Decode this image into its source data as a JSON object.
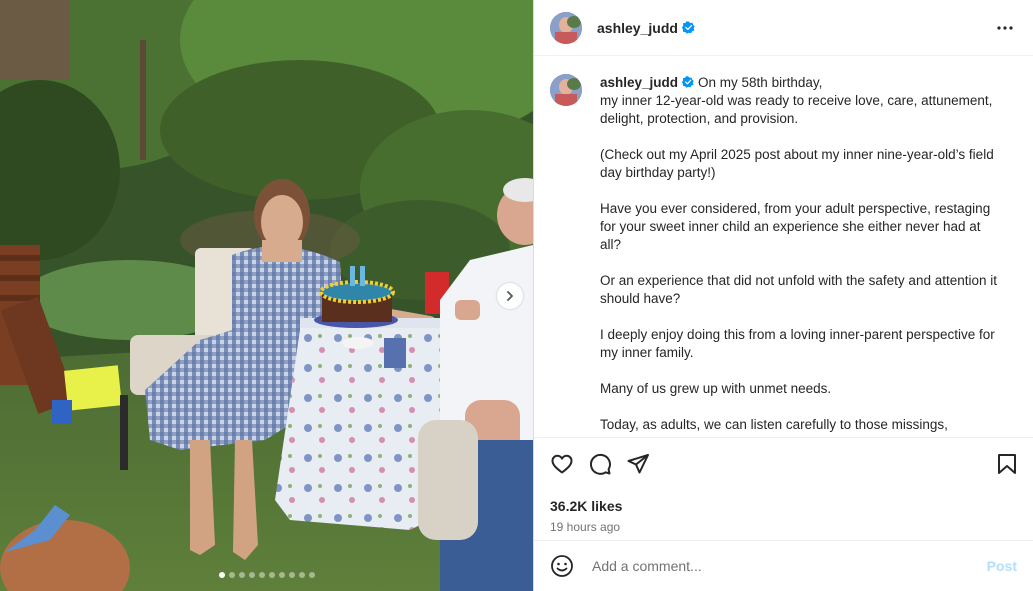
{
  "post": {
    "username": "ashley_judd",
    "verified": true,
    "colors": {
      "verified_badge": "#0095f6",
      "post_button": "#b2dffc",
      "muted_text": "#737373"
    }
  },
  "media": {
    "slide_count": 10,
    "active_slide": 1,
    "next_icon": "chevron-right-icon"
  },
  "caption": {
    "username": "ashley_judd",
    "paragraphs": [
      "On my 58th birthday,\nmy inner 12-year-old was ready to receive love, care, attunement, delight, protection, and provision.",
      "(Check out my April 2025 post about my inner nine-year-old’s field day birthday party!)",
      "Have you ever considered, from your adult perspective, restaging for your sweet inner child an experience she either never had at all?",
      "Or an experience that did not unfold with the safety and attention it should have?",
      "I deeply enjoy doing this from a loving inner-parent perspective for my inner family.",
      "Many of us grew up with unmet needs.",
      "Today, as adults, we can listen carefully to those missings,"
    ]
  },
  "actions": {
    "icons": [
      "heart-icon",
      "comment-icon",
      "share-icon",
      "bookmark-icon"
    ],
    "likes": "36.2K likes",
    "time": "19 hours ago"
  },
  "comment": {
    "placeholder": "Add a comment...",
    "post_label": "Post",
    "emoji_icon": "emoji-icon"
  }
}
